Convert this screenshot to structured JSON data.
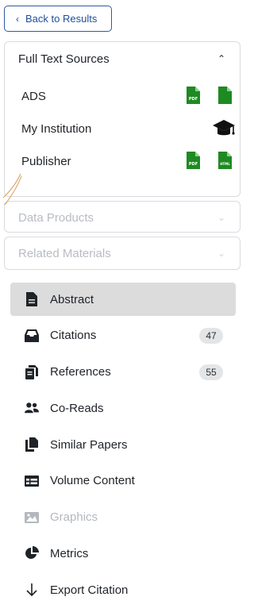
{
  "back_button": {
    "label": "Back to Results",
    "icon": "chevron-left-icon"
  },
  "full_text_sources": {
    "title": "Full Text Sources",
    "expanded": true,
    "rows": [
      {
        "label": "ADS",
        "icons": [
          "pdf-icon",
          "document-icon"
        ]
      },
      {
        "label": "My Institution",
        "icons": [
          "graduation-cap-icon"
        ]
      },
      {
        "label": "Publisher",
        "icons": [
          "pdf-icon",
          "html-icon"
        ]
      }
    ],
    "pdf_text": "PDF",
    "html_text": "HTML",
    "icon_color": "#1e8a22"
  },
  "data_products": {
    "title": "Data Products",
    "disabled": true
  },
  "related_materials": {
    "title": "Related Materials",
    "disabled": true
  },
  "nav": {
    "items": [
      {
        "label": "Abstract",
        "icon": "abstract-doc-icon",
        "active": true
      },
      {
        "label": "Citations",
        "icon": "citations-inbox-icon",
        "badge": "47"
      },
      {
        "label": "References",
        "icon": "references-copy-icon",
        "badge": "55"
      },
      {
        "label": "Co-Reads",
        "icon": "users-icon"
      },
      {
        "label": "Similar Papers",
        "icon": "similar-files-icon"
      },
      {
        "label": "Volume Content",
        "icon": "table-icon"
      },
      {
        "label": "Graphics",
        "icon": "image-icon",
        "disabled": true
      },
      {
        "label": "Metrics",
        "icon": "pie-chart-icon"
      },
      {
        "label": "Export Citation",
        "icon": "arrow-down-icon"
      }
    ]
  }
}
